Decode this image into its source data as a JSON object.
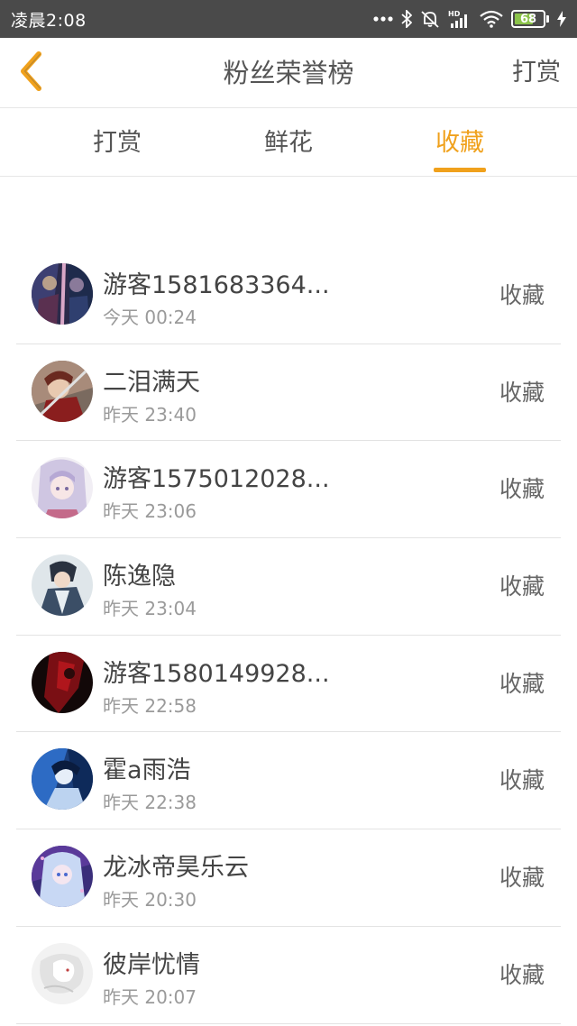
{
  "status_bar": {
    "time": "凌晨2:08",
    "battery": "68",
    "battery_level": 0.68,
    "icons": [
      "more-dots-icon",
      "bluetooth-icon",
      "mute-bell-icon",
      "hd-signal-icon",
      "wifi-icon",
      "battery-icon",
      "charging-icon"
    ]
  },
  "nav": {
    "title": "粉丝荣誉榜",
    "action_label": "打赏",
    "back_icon": "chevron-left-icon"
  },
  "tabs": [
    {
      "label": "打赏",
      "active": false
    },
    {
      "label": "鲜花",
      "active": false
    },
    {
      "label": "收藏",
      "active": true
    }
  ],
  "colors": {
    "accent": "#f0a11c",
    "status_bar": "#4a4a4a",
    "divider": "#e3e3e3"
  },
  "fans": [
    {
      "name": "游客1581683364...",
      "time": "今天 00:24",
      "action": "收藏"
    },
    {
      "name": "二泪满天",
      "time": "昨天 23:40",
      "action": "收藏"
    },
    {
      "name": "游客1575012028...",
      "time": "昨天 23:06",
      "action": "收藏"
    },
    {
      "name": "陈逸隐",
      "time": "昨天 23:04",
      "action": "收藏"
    },
    {
      "name": "游客1580149928...",
      "time": "昨天 22:58",
      "action": "收藏"
    },
    {
      "name": "霍a雨浩",
      "time": "昨天 22:38",
      "action": "收藏"
    },
    {
      "name": "龙冰帝昊乐云",
      "time": "昨天 20:30",
      "action": "收藏"
    },
    {
      "name": "彼岸忧情",
      "time": "昨天 20:07",
      "action": "收藏"
    }
  ]
}
